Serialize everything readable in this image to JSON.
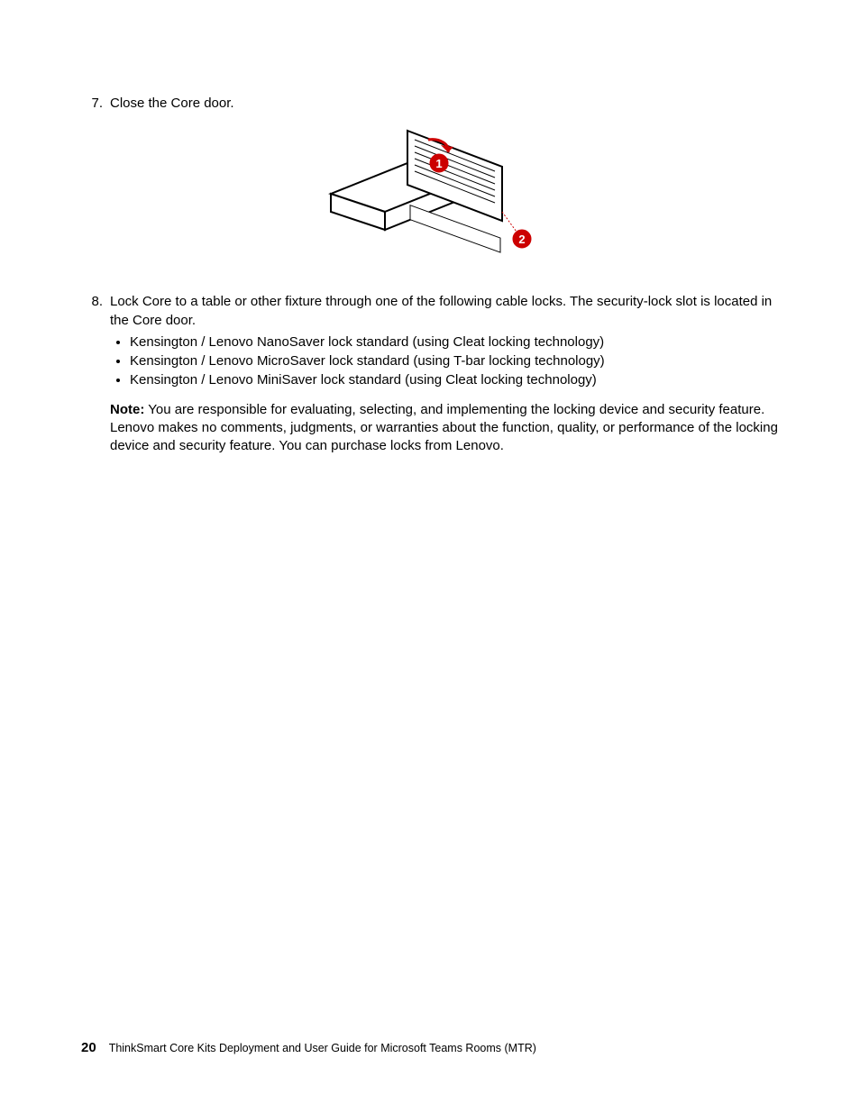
{
  "steps": {
    "s7": {
      "num": "7.",
      "text": "Close the Core door."
    },
    "s8": {
      "num": "8.",
      "intro": "Lock Core to a table or other fixture through one of the following cable locks. The security-lock slot is located in the Core door.",
      "bullets": [
        "Kensington / Lenovo NanoSaver lock standard (using Cleat locking technology)",
        "Kensington / Lenovo MicroSaver lock standard (using T-bar locking technology)",
        "Kensington / Lenovo MiniSaver lock standard (using Cleat locking technology)"
      ],
      "note_label": "Note:",
      "note_text": " You are responsible for evaluating, selecting, and implementing the locking device and security feature. Lenovo makes no comments, judgments, or warranties about the function, quality, or performance of the locking device and security feature. You can purchase locks from Lenovo."
    }
  },
  "figure": {
    "callouts": {
      "c1": "1",
      "c2": "2"
    },
    "alt": "Diagram of closing the Core door with callouts 1 and 2"
  },
  "footer": {
    "page": "20",
    "title": "ThinkSmart Core Kits Deployment and User Guide for Microsoft Teams Rooms (MTR)"
  }
}
